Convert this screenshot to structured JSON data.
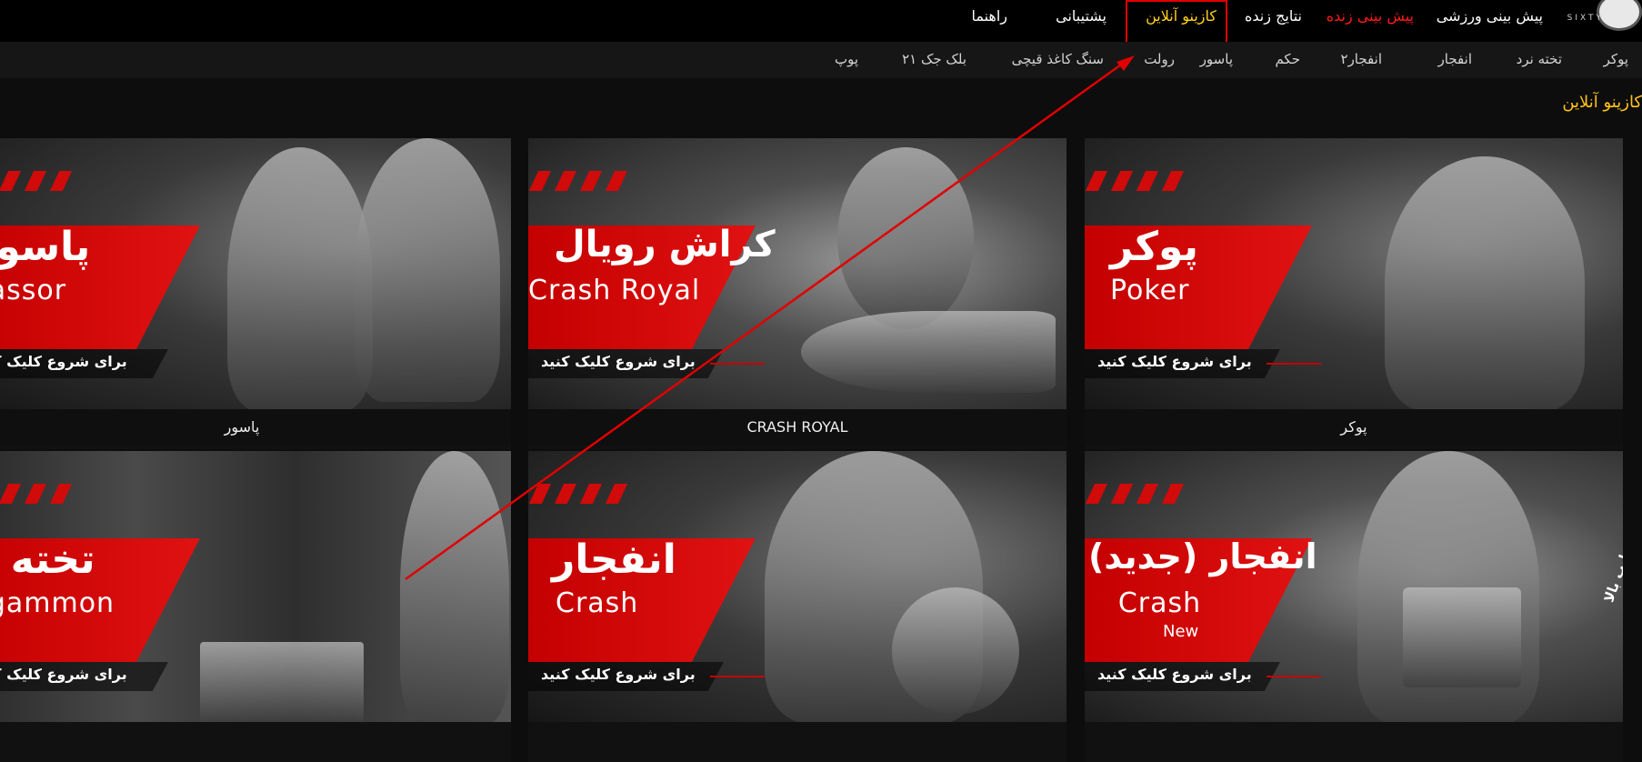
{
  "logo": {
    "text": "SIXTY"
  },
  "nav": {
    "items": [
      {
        "label": "پیش بینی ورزشی",
        "style": "normal"
      },
      {
        "label": "پیش بینی زنده",
        "style": "red"
      },
      {
        "label": "نتایج زنده",
        "style": "normal"
      },
      {
        "label": "کازینو آنلاین",
        "style": "gold"
      },
      {
        "label": "پشتیبانی",
        "style": "normal"
      },
      {
        "label": "راهنما",
        "style": "normal"
      }
    ]
  },
  "subnav": {
    "items": [
      "پوکر",
      "تخته نرد",
      "انفجار",
      "انفجار۲",
      "حکم",
      "پاسور",
      "رولت",
      "سنگ کاغذ قیچی",
      "بلک جک ۲۱",
      "پوپ"
    ]
  },
  "section": {
    "title": "کازینو آنلاین"
  },
  "cards": [
    {
      "title_fa": "پوکر",
      "title_en": "Poker",
      "new": "",
      "cta": "برای شروع کلیک کنید",
      "caption": "پوکر"
    },
    {
      "title_fa": "کراش رویال",
      "title_en": "Crash Royal",
      "new": "",
      "cta": "برای شروع کلیک کنید",
      "caption": "CRASH ROYAL"
    },
    {
      "title_fa": "پاسور",
      "title_en": "Passor",
      "new": "",
      "cta": "برای شروع کلیک کنید",
      "caption": "پاسور"
    },
    {
      "title_fa": "انفجار (جدید)",
      "title_en": "Crash",
      "new": "New",
      "cta": "برای شروع کلیک کنید",
      "caption": "",
      "side_label": "ضرایب بالا"
    },
    {
      "title_fa": "انفجار",
      "title_en": "Crash",
      "new": "",
      "cta": "برای شروع کلیک کنید",
      "caption": ""
    },
    {
      "title_fa": "تخته نرد",
      "title_en": "Backgammon",
      "new": "",
      "cta": "برای شروع کلیک کنید",
      "caption": ""
    }
  ],
  "colors": {
    "accent_red": "#d10a0a",
    "nav_gold": "#ffd21a",
    "nav_red": "#ff1a1a",
    "annotation": "#e00000"
  }
}
